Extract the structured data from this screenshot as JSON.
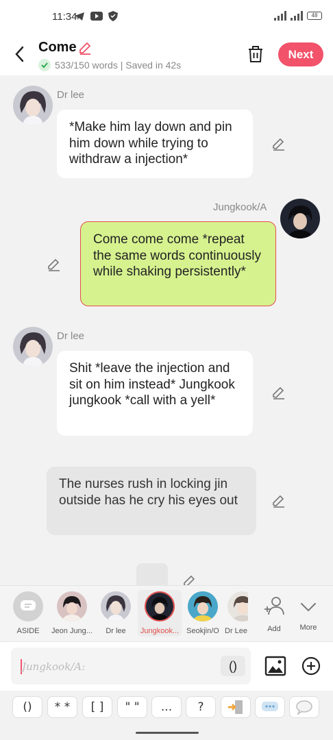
{
  "status_bar": {
    "time": "11:34",
    "battery": "48"
  },
  "header": {
    "title": "Come",
    "subtitle": "533/150 words | Saved in 42s",
    "next_label": "Next"
  },
  "messages": [
    {
      "speaker": "Dr lee",
      "side": "left",
      "text": "*Make him lay down and pin him down while trying to withdraw a injection*"
    },
    {
      "speaker": "Jungkook/A",
      "side": "right",
      "text": "Come come come *repeat the same words continuously while shaking persistently*"
    },
    {
      "speaker": "Dr lee",
      "side": "left",
      "text": "Shit *leave the injection and sit on him instead* Jungkook jungkook *call with a yell*"
    },
    {
      "speaker": "",
      "side": "narration",
      "text": "The nurses rush in locking jin outside has he cry his eyes out"
    }
  ],
  "characters": [
    {
      "label": "ASIDE"
    },
    {
      "label": "Jeon Jung..."
    },
    {
      "label": "Dr lee"
    },
    {
      "label": "Jungkook..."
    },
    {
      "label": "Seokjin/O"
    },
    {
      "label": "Dr Lee"
    },
    {
      "label": "Add"
    },
    {
      "label": "More"
    }
  ],
  "input": {
    "placeholder": "Jungkook/A:",
    "paren_label": "()"
  },
  "quick_buttons": [
    "()",
    "* *",
    "[ ]",
    "\" \"",
    "...",
    "?",
    "",
    "",
    ""
  ],
  "colors": {
    "accent": "#f2526a",
    "user_bubble": "#d6f28f"
  }
}
